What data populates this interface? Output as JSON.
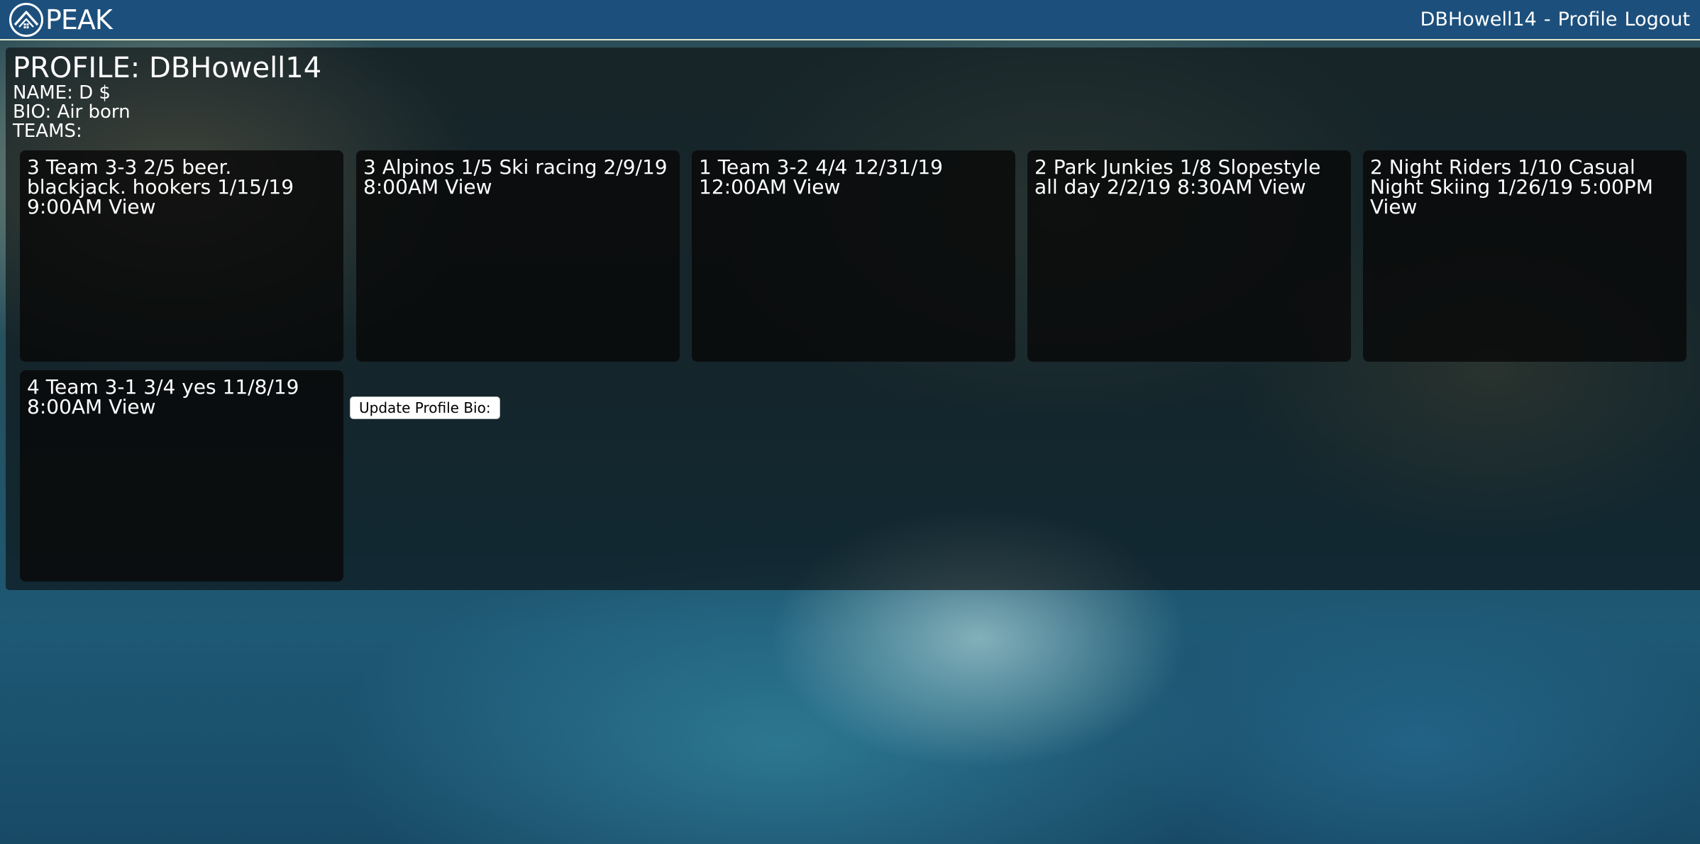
{
  "header": {
    "brand": "PEAK",
    "username": "DBHowell14",
    "separator": "-",
    "profile_link": "Profile",
    "logout_link": "Logout"
  },
  "profile": {
    "title": "PROFILE: DBHowell14",
    "name_line": "NAME: D $",
    "bio_line": "BIO: Air born",
    "teams_label": "TEAMS:"
  },
  "teams": [
    {
      "text": "3 Team 3-3 2/5 beer. blackjack. hookers 1/15/19 9:00AM",
      "view": "View"
    },
    {
      "text": "3 Alpinos 1/5 Ski racing 2/9/19 8:00AM",
      "view": "View"
    },
    {
      "text": "1 Team 3-2 4/4 12/31/19 12:00AM",
      "view": "View"
    },
    {
      "text": "2 Park Junkies 1/8 Slopestyle all day 2/2/19 8:30AM",
      "view": "View"
    },
    {
      "text": "2 Night Riders 1/10 Casual Night Skiing 1/26/19 5:00PM",
      "view": "View"
    },
    {
      "text": "4 Team 3-1 3/4 yes 11/8/19 8:00AM",
      "view": "View"
    }
  ],
  "update_bio_button": "Update Profile Bio:",
  "icons": {
    "logo": "peak-mountain-logo-icon"
  },
  "colors": {
    "header_bg": "#1c4f7c",
    "panel_bg": "rgba(10,10,10,0.6)",
    "card_bg": "rgba(8,8,8,0.82)"
  }
}
